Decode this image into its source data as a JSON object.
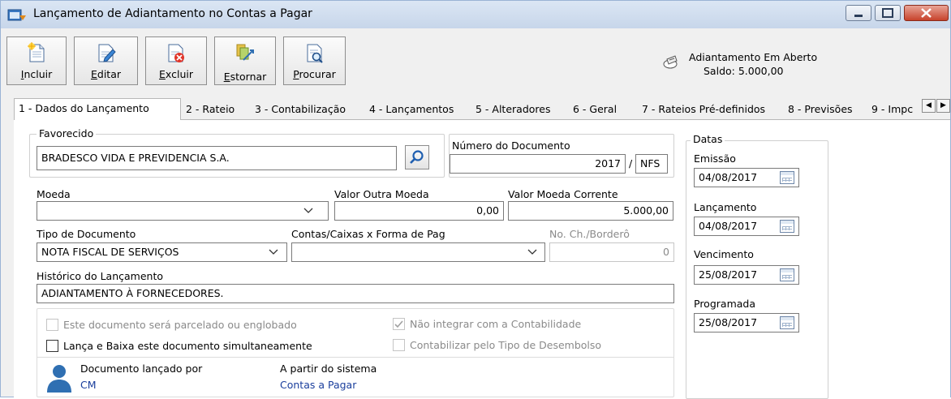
{
  "window": {
    "title": "Lançamento de Adiantamento no Contas a Pagar"
  },
  "toolbar": {
    "incluir": "Incluir",
    "editar": "Editar",
    "excluir": "Excluir",
    "estornar": "Estornar",
    "procurar": "Procurar"
  },
  "adiantamento": {
    "title": "Adiantamento Em Aberto",
    "saldo": "Saldo: 5.000,00"
  },
  "tabs": [
    "1 - Dados do Lançamento",
    "2 - Rateio",
    "3 - Contabilização",
    "4 - Lançamentos",
    "5 - Alteradores",
    "6 - Geral",
    "7 - Rateios Pré-definidos",
    "8 - Previsões",
    "9 - Impc"
  ],
  "form": {
    "favorecido_label": "Favorecido",
    "favorecido_value": "BRADESCO VIDA E PREVIDENCIA S.A.",
    "num_doc_label": "Número do Documento",
    "num_doc_value": "2017",
    "num_doc_sep": "/",
    "num_doc_serie": "NFS",
    "moeda_label": "Moeda",
    "moeda_value": "",
    "valor_outra_label": "Valor Outra Moeda",
    "valor_outra_value": "0,00",
    "valor_corrente_label": "Valor Moeda Corrente",
    "valor_corrente_value": "5.000,00",
    "tipo_doc_label": "Tipo de Documento",
    "tipo_doc_value": "NOTA FISCAL DE SERVIÇOS",
    "contas_label": "Contas/Caixas x Forma de Pag",
    "contas_value": "",
    "no_ch_label": "No. Ch./Borderô",
    "no_ch_value": "0",
    "historico_label": "Histórico do Lançamento",
    "historico_value": "ADIANTAMENTO À FORNECEDORES."
  },
  "options": {
    "parcelado": "Este documento será parcelado ou englobado",
    "lanca_baixa": "Lança e Baixa este documento simultaneamente",
    "nao_integrar": "Não integrar com a Contabilidade",
    "contabilizar": "Contabilizar pelo Tipo de Desembolso"
  },
  "footer": {
    "lancado_por_label": "Documento lançado por",
    "lancado_por_value": "CM",
    "sistema_label": "A partir do sistema",
    "sistema_value": "Contas a Pagar"
  },
  "datas": {
    "title": "Datas",
    "emissao_label": "Emissão",
    "emissao_value": "04/08/2017",
    "lancamento_label": "Lançamento",
    "lancamento_value": "04/08/2017",
    "vencimento_label": "Vencimento",
    "vencimento_value": "25/08/2017",
    "programada_label": "Programada",
    "programada_value": "25/08/2017"
  },
  "colors": {
    "link_blue": "#1a3e9c",
    "user_icon_blue": "#2f6fb2"
  }
}
